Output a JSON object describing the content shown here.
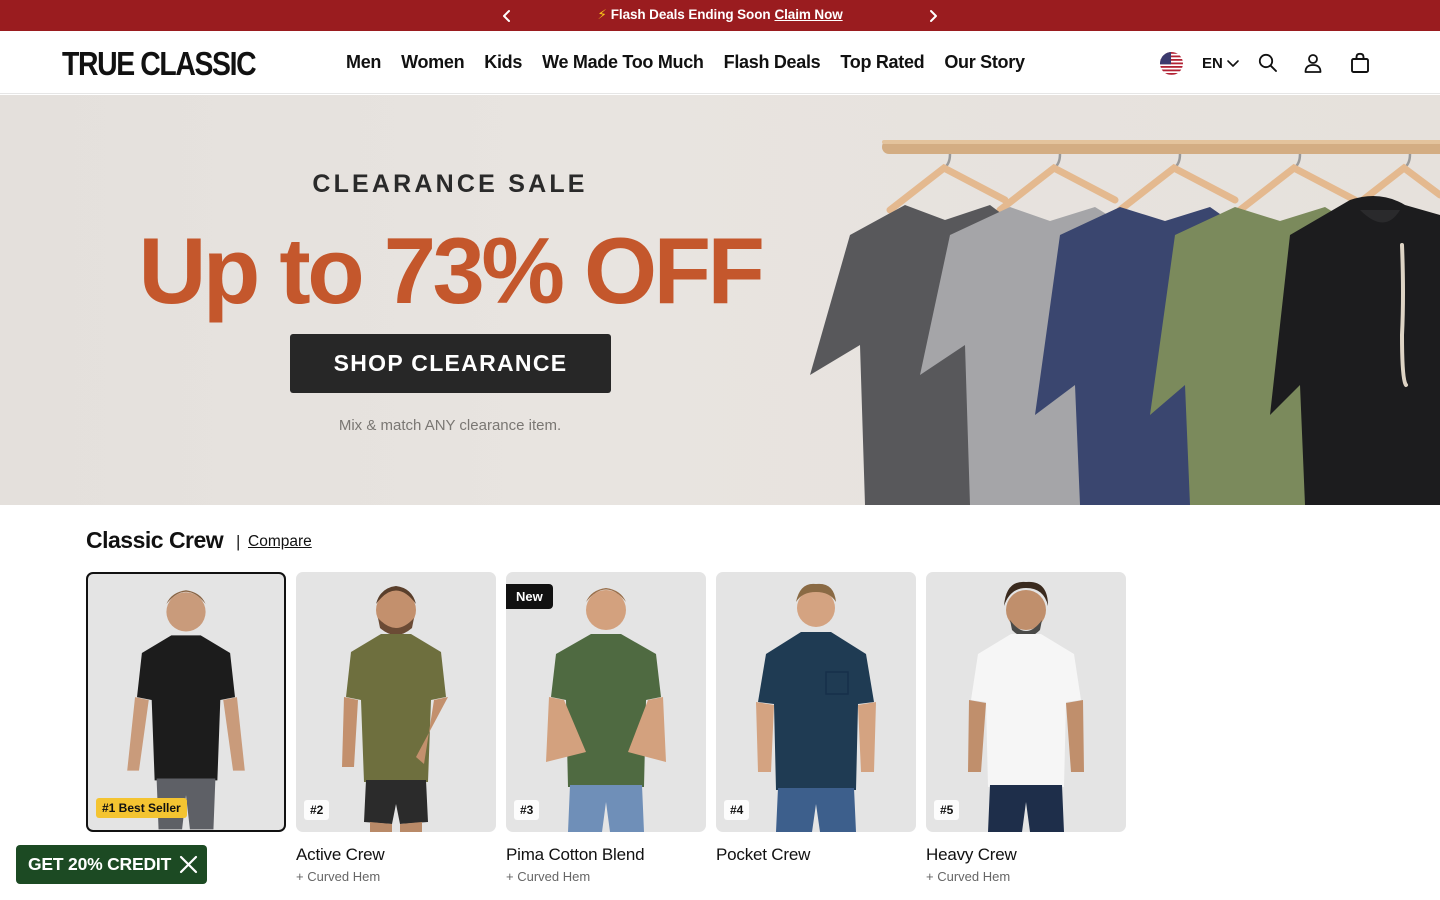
{
  "announcement": {
    "bolt": "⚡",
    "text": "Flash Deals Ending Soon",
    "link": "Claim Now",
    "background": "#9a1c1f"
  },
  "header": {
    "logo": "TRUE CLASSIC",
    "nav": [
      "Men",
      "Women",
      "Kids",
      "We Made Too Much",
      "Flash Deals",
      "Top Rated",
      "Our Story"
    ],
    "language": "EN",
    "icons": [
      "us-flag-icon",
      "chevron-down-icon",
      "search-icon",
      "account-icon",
      "cart-icon"
    ]
  },
  "hero": {
    "eyebrow": "CLEARANCE SALE",
    "headline": "Up to 73% OFF",
    "cta": "SHOP CLEARANCE",
    "subtext": "Mix & match ANY clearance item.",
    "accent_color": "#c4572c"
  },
  "collection": {
    "title": "Classic Crew",
    "separator": "|",
    "compare": "Compare",
    "products": [
      {
        "name": "",
        "sub": "",
        "rank": "#1 Best Seller",
        "color": "#1c1c1c"
      },
      {
        "name": "Active Crew",
        "sub": "+ Curved Hem",
        "rank": "#2",
        "color": "#6e6f3e"
      },
      {
        "name": "Pima Cotton Blend",
        "sub": "+ Curved Hem",
        "rank": "#3",
        "badge": "New",
        "color": "#4f6a41"
      },
      {
        "name": "Pocket Crew",
        "sub": "",
        "rank": "#4",
        "color": "#1f3b53"
      },
      {
        "name": "Heavy Crew",
        "sub": "+ Curved Hem",
        "rank": "#5",
        "color": "#f6f6f6"
      }
    ]
  },
  "promo": {
    "label": "GET 20% CREDIT",
    "color": "#1c4a23"
  }
}
